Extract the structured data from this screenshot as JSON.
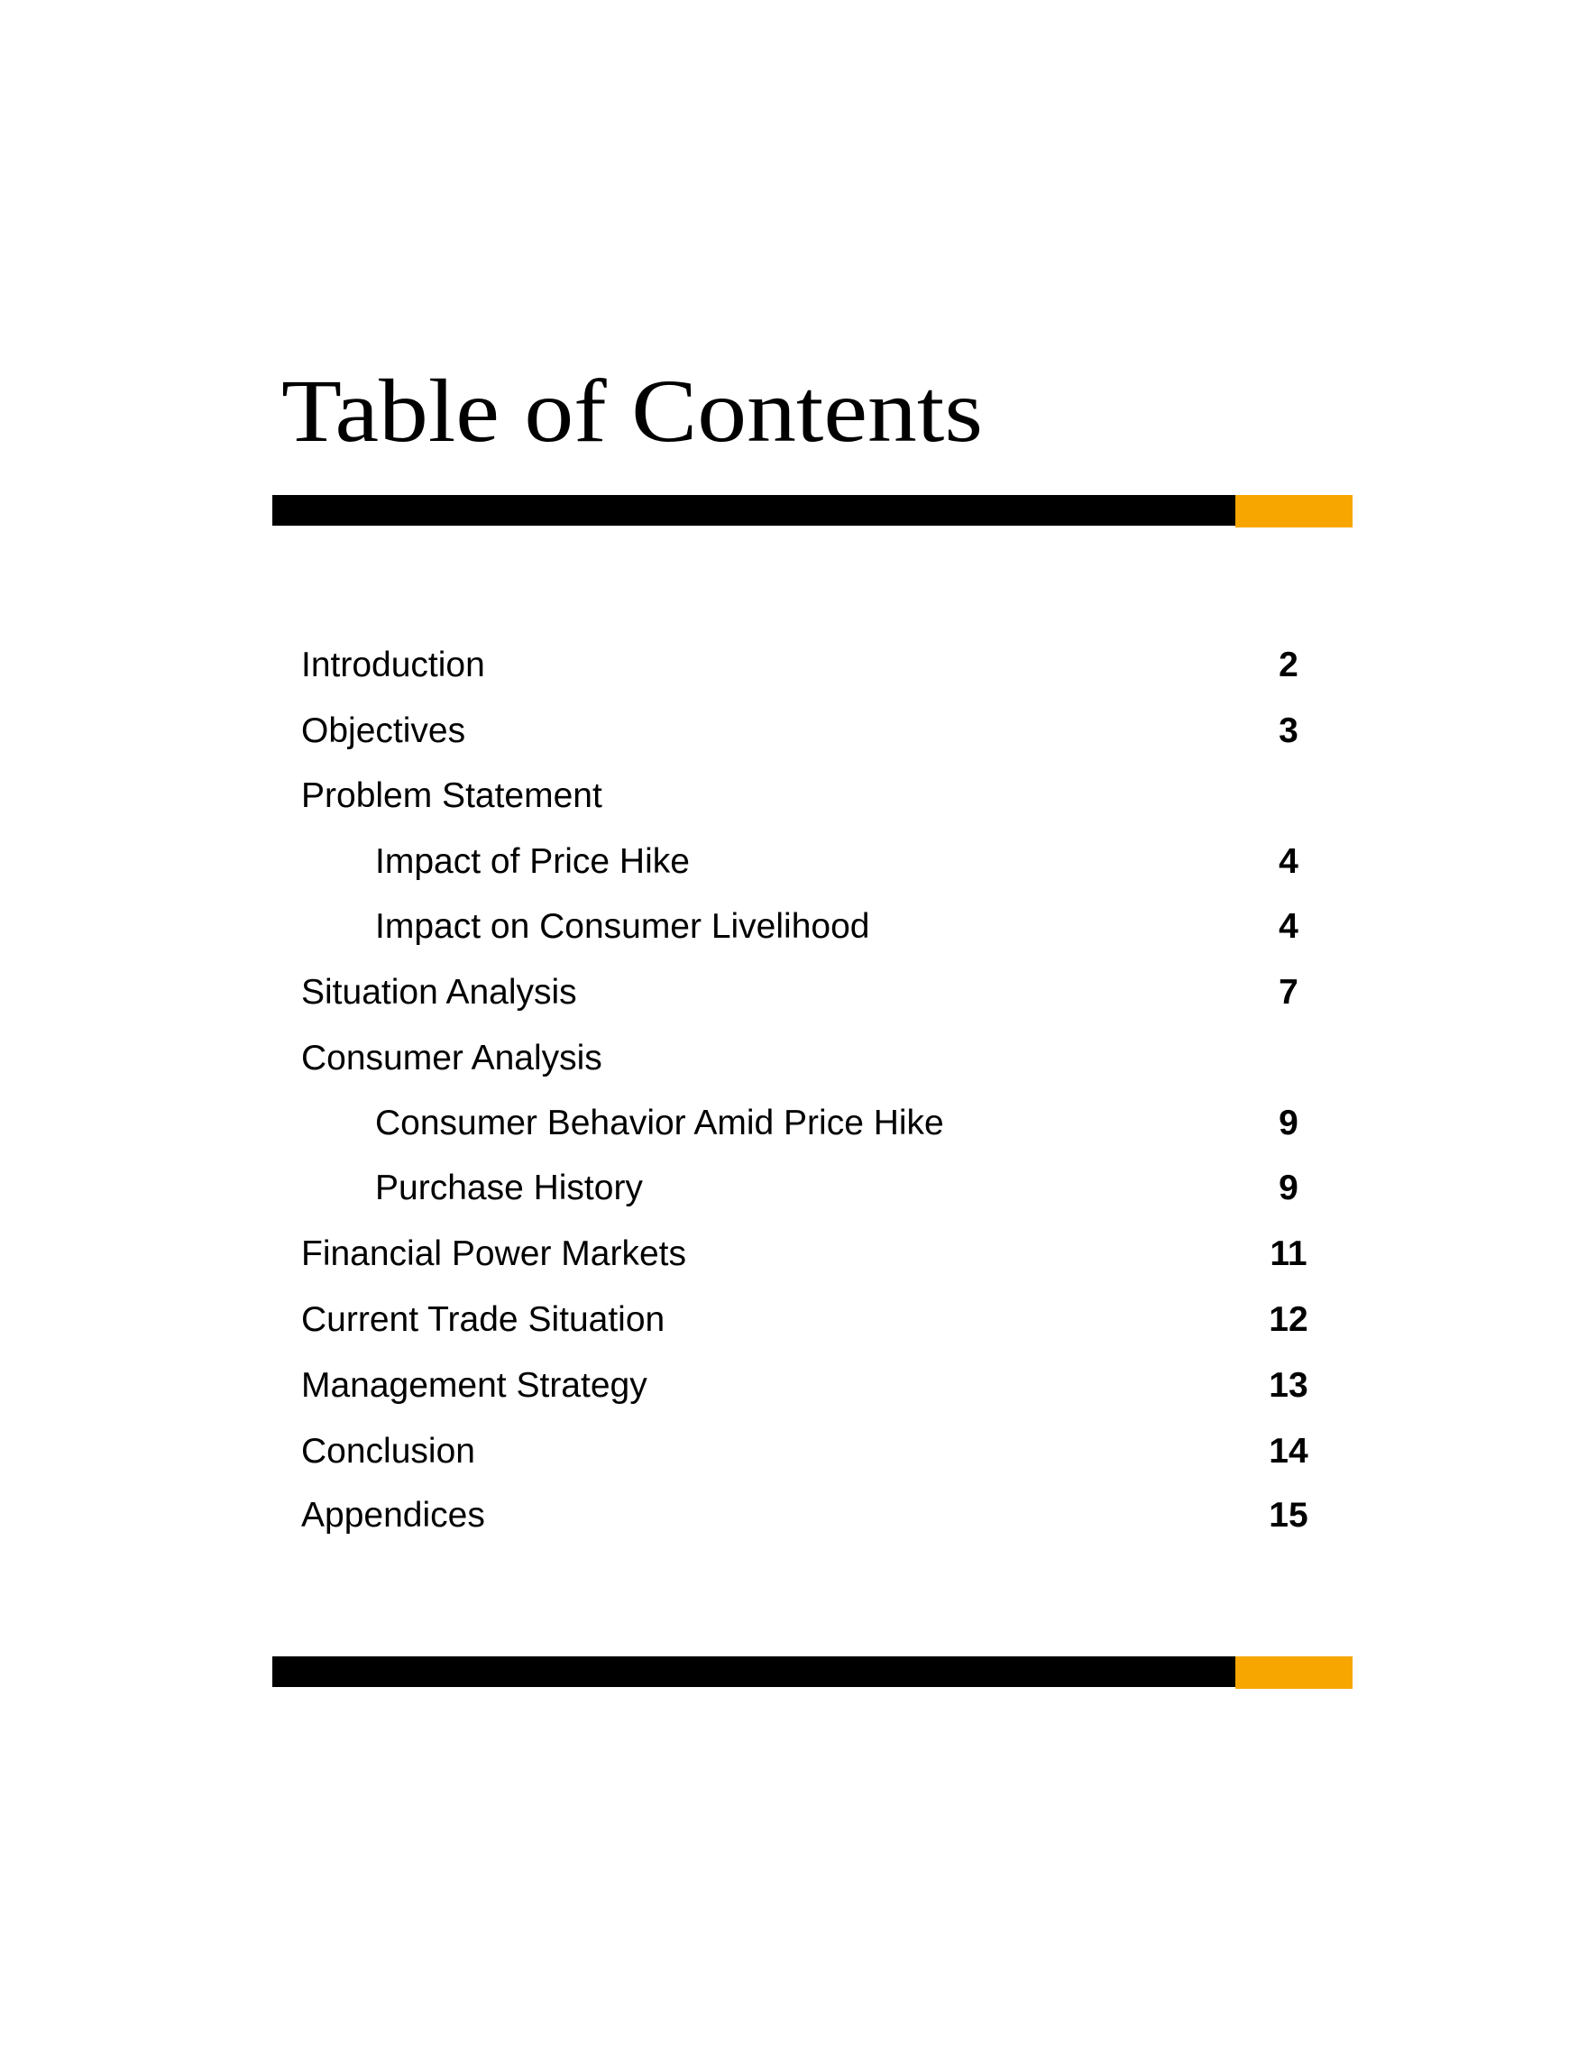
{
  "page": {
    "title": "Table of Contents",
    "colors": {
      "rule_primary": "#000000",
      "rule_accent": "#f7a600",
      "text": "#000000",
      "background": "#ffffff"
    }
  },
  "toc": {
    "entries": [
      {
        "label": "Introduction",
        "page": "2",
        "level": 1
      },
      {
        "label": "Objectives",
        "page": "3",
        "level": 1
      },
      {
        "label": "Problem Statement",
        "page": "",
        "level": 1
      },
      {
        "label": "Impact of Price Hike",
        "page": "4",
        "level": 2
      },
      {
        "label": "Impact on Consumer Livelihood",
        "page": "4",
        "level": 2
      },
      {
        "label": "Situation Analysis",
        "page": "7",
        "level": 1
      },
      {
        "label": "Consumer Analysis",
        "page": "",
        "level": 1
      },
      {
        "label": "Consumer Behavior Amid Price Hike",
        "page": "9",
        "level": 2
      },
      {
        "label": "Purchase History",
        "page": "9",
        "level": 2
      },
      {
        "label": "Financial Power Markets",
        "page": "11",
        "level": 1
      },
      {
        "label": "Current Trade Situation",
        "page": "12",
        "level": 1
      },
      {
        "label": "Management Strategy",
        "page": "13",
        "level": 1
      },
      {
        "label": "Conclusion",
        "page": "14",
        "level": 1
      },
      {
        "label": "Appendices",
        "page": "15",
        "level": 1
      }
    ]
  }
}
